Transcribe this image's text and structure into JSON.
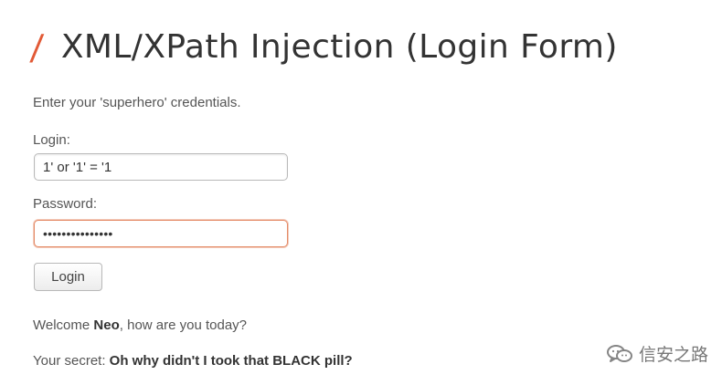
{
  "title": {
    "slash": "/",
    "text": "XML/XPath Injection (Login Form)"
  },
  "form": {
    "intro": "Enter your 'superhero' credentials.",
    "login": {
      "label": "Login:",
      "value": "1' or '1' = '1"
    },
    "password": {
      "label": "Password:",
      "masked_value": "•••••••••••••••"
    },
    "button_label": "Login"
  },
  "result": {
    "welcome_prefix": "Welcome ",
    "username": "Neo",
    "welcome_suffix": ", how are you today?",
    "secret_prefix": "Your secret: ",
    "secret_value": "Oh why didn't I took that BLACK pill?"
  },
  "watermark": {
    "icon": "wechat-icon",
    "text": "信安之路"
  },
  "colors": {
    "accent": "#e25a36",
    "focus_border": "#e48b68"
  }
}
